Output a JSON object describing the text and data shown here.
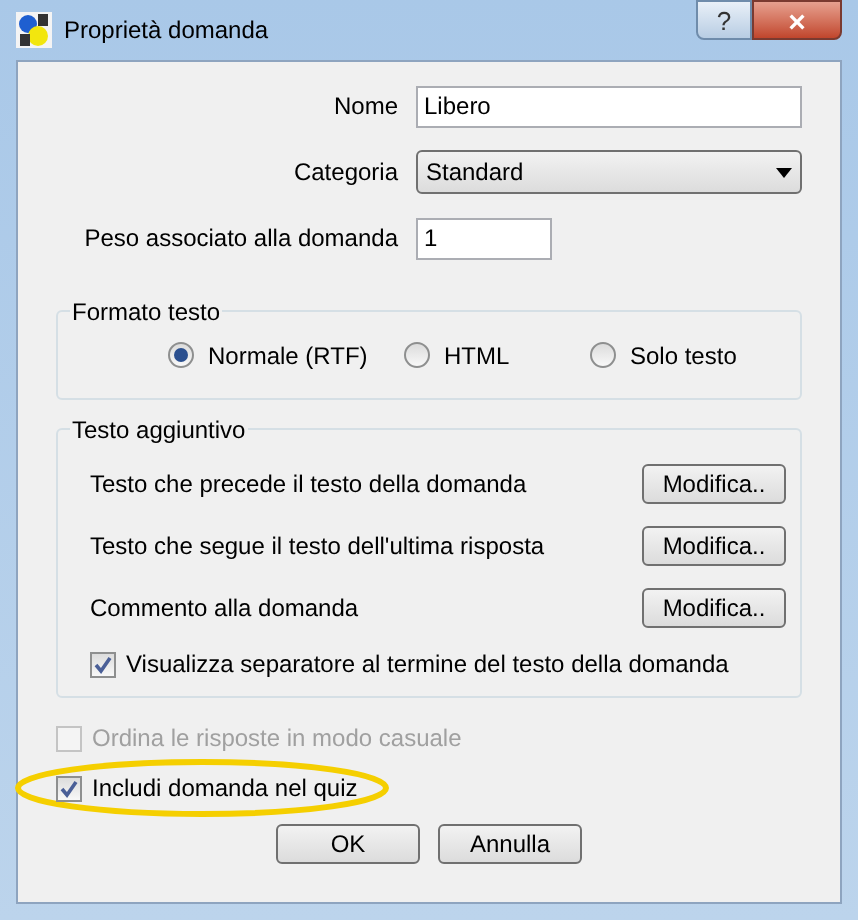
{
  "window": {
    "title": "Proprietà domanda",
    "buttons": [
      "?",
      "×"
    ]
  },
  "fields": [
    {
      "kind": "text",
      "label": "Nome",
      "value": "Libero"
    },
    {
      "kind": "combo",
      "label": "Categoria",
      "value": "Standard"
    },
    {
      "kind": "short",
      "label": "Peso associato alla domanda",
      "value": "1"
    }
  ],
  "format_group": {
    "title": "Formato testo",
    "options": [
      {
        "label": "Normale (RTF)",
        "selected": true
      },
      {
        "label": "HTML",
        "selected": false
      },
      {
        "label": "Solo testo",
        "selected": false
      }
    ]
  },
  "extra_group": {
    "title": "Testo aggiuntivo",
    "rows": [
      {
        "label": "Testo che precede il testo della domanda",
        "button": "Modifica.."
      },
      {
        "label": "Testo che segue il testo dell'ultima risposta",
        "button": "Modifica.."
      },
      {
        "label": "Commento alla domanda",
        "button": "Modifica.."
      }
    ],
    "checkbox": {
      "label": "Visualizza separatore al termine del testo della domanda",
      "checked": true,
      "disabled": false
    }
  },
  "options": [
    {
      "label": "Ordina le risposte in modo casuale",
      "checked": false,
      "disabled": true,
      "highlighted": false
    },
    {
      "label": "Includi domanda nel quiz",
      "checked": true,
      "disabled": false,
      "highlighted": true
    }
  ],
  "buttons": [
    "OK",
    "Annulla"
  ]
}
